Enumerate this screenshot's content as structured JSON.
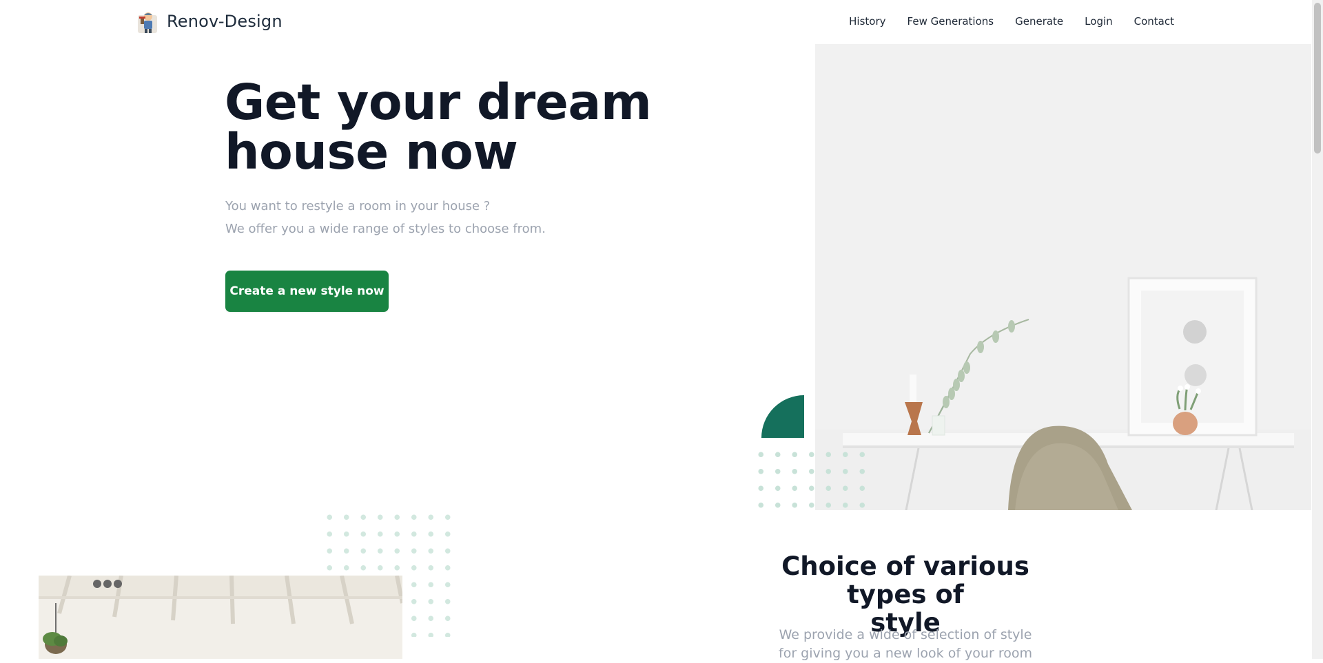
{
  "header": {
    "brand": "Renov-Design",
    "nav": [
      {
        "label": "History"
      },
      {
        "label": "Few Generations"
      },
      {
        "label": "Generate"
      },
      {
        "label": "Login"
      },
      {
        "label": "Contact"
      }
    ]
  },
  "hero": {
    "title_line1": "Get your dream",
    "title_line2": "house now",
    "subtitle_line1": "You want to restyle a room in your house ?",
    "subtitle_line2": "We offer you a wide range of styles to choose from.",
    "cta_label": "Create a new style now"
  },
  "section": {
    "title_line1": "Choice of various types of",
    "title_line2": "style",
    "text_line1": "We provide a wide of selection of style",
    "text_line2": "for giving you a new look of your room"
  },
  "colors": {
    "accent": "#198442",
    "half_circle": "#15705c",
    "text_muted": "#9ca3af",
    "heading": "#111827"
  },
  "icons": {
    "logo": "painter-logo-icon"
  }
}
